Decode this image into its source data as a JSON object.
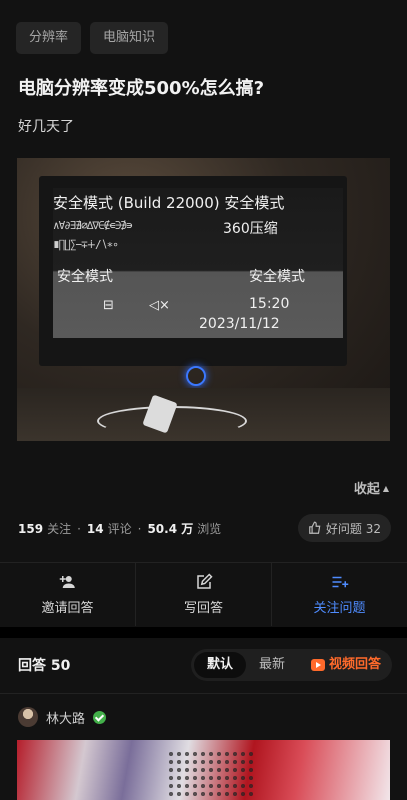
{
  "tags": [
    "分辨率",
    "电脑知识"
  ],
  "question": {
    "title": "电脑分辨率变成500%怎么搞?",
    "description": "好几天了"
  },
  "photo": {
    "screen_lines": [
      "安全模式 (Build 22000) 安全模式",
      "360压缩",
      "安全模式",
      "安全模式",
      "15:20",
      "2023/11/12"
    ]
  },
  "collapse_label": "收起",
  "stats": {
    "followers": "159",
    "followers_label": "关注",
    "comments": "14",
    "comments_label": "评论",
    "views": "50.4 万",
    "views_label": "浏览",
    "good_question_label": "好问题 32"
  },
  "actions": [
    {
      "label": "邀请回答",
      "icon": "add-user-icon"
    },
    {
      "label": "写回答",
      "icon": "edit-icon"
    },
    {
      "label": "关注问题",
      "icon": "follow-list-icon"
    }
  ],
  "answers": {
    "label": "回答 50",
    "sort_options": [
      "默认",
      "最新",
      "视频回答"
    ],
    "active_sort": "默认"
  },
  "author": {
    "name": "林大路"
  },
  "colors": {
    "background": "#121212",
    "accent_blue": "#4f8cff",
    "video_orange": "#ff6a2b",
    "verified_green": "#43b04a"
  }
}
